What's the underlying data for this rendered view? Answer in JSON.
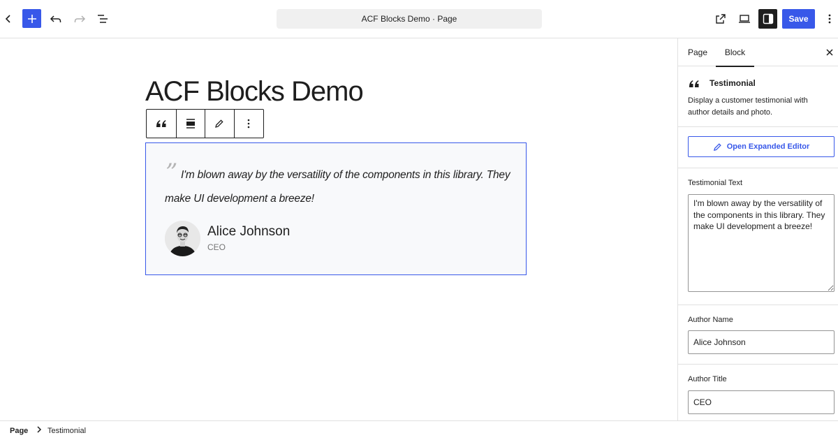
{
  "header": {
    "document_title": "ACF Blocks Demo · Page",
    "save_label": "Save",
    "accent_color": "#3858e9"
  },
  "canvas": {
    "page_title": "ACF Blocks Demo",
    "block_toolbar": {
      "icons": [
        "quote-icon",
        "align-icon",
        "edit-pencil-icon",
        "more-vertical-icon"
      ]
    },
    "testimonial": {
      "quote_mark": "”",
      "text": "I'm blown away by the versatility of the components in this library. They make UI development a breeze!",
      "author_name": "Alice Johnson",
      "author_title": "CEO"
    }
  },
  "sidebar": {
    "tabs": [
      "Page",
      "Block"
    ],
    "active_tab": "Block",
    "block_card": {
      "title": "Testimonial",
      "description": "Display a customer testimonial with author details and photo."
    },
    "expand_button_label": "Open Expanded Editor",
    "fields": {
      "testimonial_text": {
        "label": "Testimonial Text",
        "value": "I'm blown away by the versatility of the components in this library. They make UI development a breeze!"
      },
      "author_name": {
        "label": "Author Name",
        "value": "Alice Johnson"
      },
      "author_title": {
        "label": "Author Title",
        "value": "CEO"
      }
    }
  },
  "footer": {
    "breadcrumb": [
      "Page",
      "Testimonial"
    ]
  }
}
